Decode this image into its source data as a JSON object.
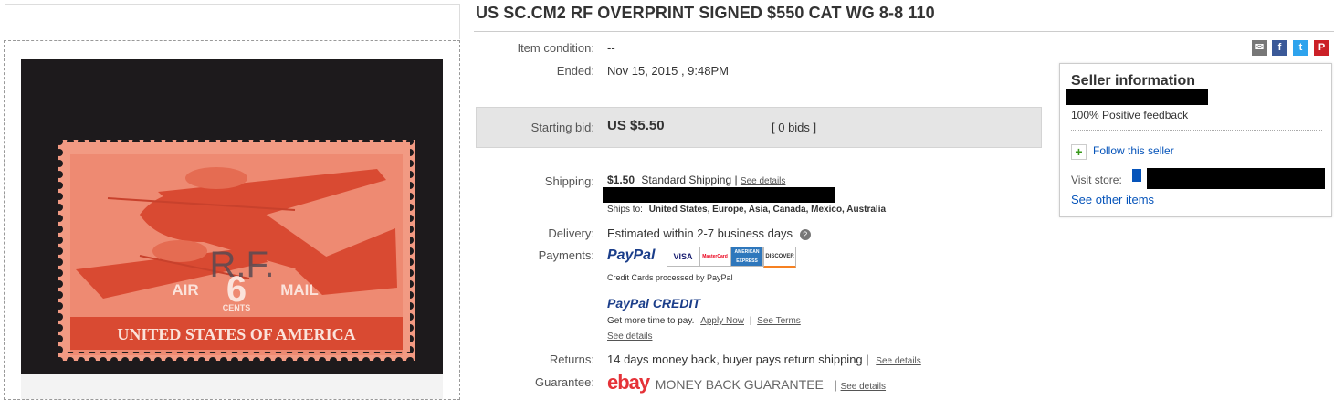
{
  "listing": {
    "title": "US SC.CM2 RF OVERPRINT SIGNED $550 CAT WG 8-8 110",
    "condition_label": "Item condition:",
    "condition_value": "--",
    "ended_label": "Ended:",
    "ended_value": "Nov 15, 2015 , 9:48PM",
    "bid_label": "Starting bid:",
    "bid_value": "US $5.50",
    "bids_link": "[ 0 bids ]",
    "shipping_label": "Shipping:",
    "shipping_price": "$1.50",
    "shipping_method": "Standard Shipping |",
    "shipping_details": "See details",
    "ships_to_label": "Ships to:",
    "ships_to_value": "United States, Europe, Asia, Canada, Mexico, Australia",
    "delivery_label": "Delivery:",
    "delivery_value": "Estimated within 2-7 business days",
    "payments_label": "Payments:",
    "paypal": "PayPal",
    "cards": [
      "VISA",
      "MasterCard",
      "AMERICAN EXPRESS",
      "DISCOVER"
    ],
    "credit_note": "Credit Cards processed by PayPal",
    "paypal_credit": "PayPal CREDIT",
    "credit_more": "Get more time to pay.",
    "apply_now": "Apply Now",
    "see_terms": "See Terms",
    "see_details": "See details",
    "returns_label": "Returns:",
    "returns_value": "14 days money back, buyer pays return shipping |",
    "guarantee_label": "Guarantee:",
    "guarantee_brand": "ebay",
    "guarantee_text": "MONEY BACK GUARANTEE",
    "guarantee_sep": "|"
  },
  "stamp": {
    "overprint": "R.F.",
    "air": "AIR",
    "mail": "MAIL",
    "value": "6",
    "cents": "CENTS",
    "country": "UNITED STATES OF AMERICA"
  },
  "seller": {
    "heading": "Seller information",
    "feedback": "100% Positive feedback",
    "follow": "Follow this seller",
    "visit_store": "Visit store:",
    "other_items": "See other items"
  },
  "share_icons": [
    "email-icon",
    "facebook-icon",
    "twitter-icon",
    "pinterest-icon"
  ],
  "colors": {
    "link": "#0654ba",
    "stamp_red": "#e8593f",
    "bid_box": "#e5e5e5"
  }
}
